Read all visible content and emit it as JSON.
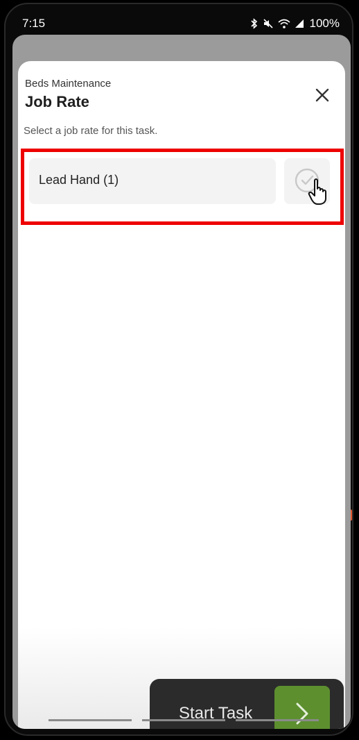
{
  "status_bar": {
    "time": "7:15",
    "battery": "100%"
  },
  "sheet": {
    "subtitle": "Beds Maintenance",
    "title": "Job Rate",
    "instruction": "Select a job rate for this task."
  },
  "job_rates": [
    {
      "label": "Lead Hand (1)"
    }
  ],
  "footer": {
    "start_label": "Start Task"
  },
  "colors": {
    "highlight": "#ee0000",
    "accent_green": "#5d8f2f",
    "start_button_bg": "#2b2b2b"
  },
  "icons": [
    "bluetooth-icon",
    "mute-icon",
    "wifi-icon",
    "signal-icon",
    "close-icon",
    "check-circle-icon",
    "hand-cursor-icon",
    "chevron-right-icon"
  ]
}
